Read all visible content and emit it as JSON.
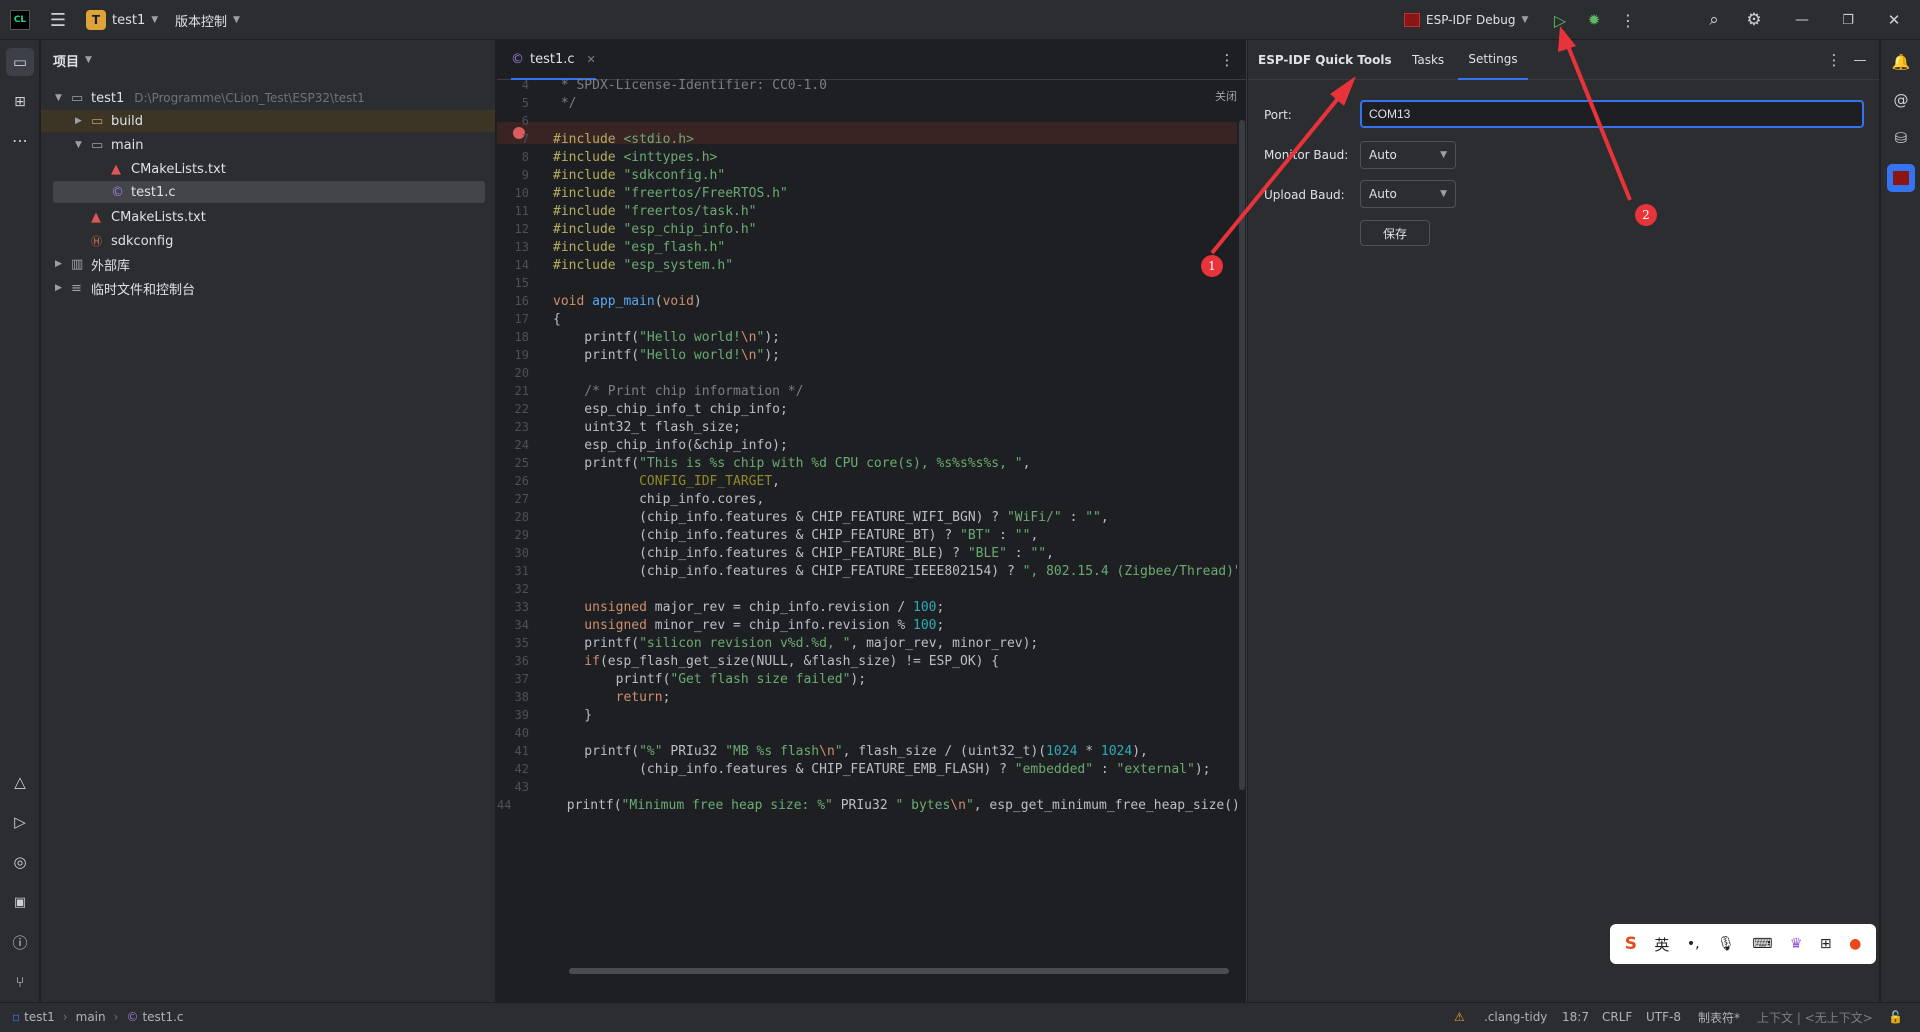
{
  "titlebar": {
    "project_badge": "T",
    "project_name": "test1",
    "vcs_label": "版本控制",
    "run_config": "ESP-IDF Debug"
  },
  "project_panel": {
    "title": "项目",
    "root_name": "test1",
    "root_path": "D:\\Programme\\CLion_Test\\ESP32\\test1",
    "items": [
      {
        "label": "build"
      },
      {
        "label": "main"
      },
      {
        "label": "CMakeLists.txt"
      },
      {
        "label": "test1.c"
      },
      {
        "label": "CMakeLists.txt"
      },
      {
        "label": "sdkconfig"
      },
      {
        "label": "外部库"
      },
      {
        "label": "临时文件和控制台"
      }
    ]
  },
  "editor": {
    "tab_label": "test1.c",
    "close_hint": "关闭",
    "line_numbers": [
      "4",
      "5",
      "6",
      "7",
      "8",
      "9",
      "10",
      "11",
      "12",
      "13",
      "14",
      "15",
      "16",
      "17",
      "18",
      "19",
      "20",
      "21",
      "22",
      "23",
      "24",
      "25",
      "26",
      "27",
      "28",
      "29",
      "30",
      "31",
      "32",
      "33",
      "34",
      "35",
      "36",
      "37",
      "38",
      "39",
      "40",
      "41",
      "42",
      "43",
      "44"
    ]
  },
  "tool_window": {
    "title": "ESP-IDF Quick Tools",
    "tabs": [
      "Tasks",
      "Settings"
    ],
    "port_label": "Port:",
    "port_value": "COM13",
    "monitor_label": "Monitor Baud:",
    "monitor_value": "Auto",
    "upload_label": "Upload Baud:",
    "upload_value": "Auto",
    "save_label": "保存"
  },
  "annotations": {
    "badge1": "1",
    "badge2": "2"
  },
  "ime": {
    "lang": "英"
  },
  "statusbar": {
    "crumbs": [
      "test1",
      "main",
      "test1.c"
    ],
    "inspection": ".clang-tidy",
    "position": "18:7",
    "line_sep": "CRLF",
    "encoding": "UTF-8",
    "indent": "制表符*",
    "context": "上下文 | <无上下文>"
  },
  "colors": {
    "accent": "#3574f0",
    "run": "#5fb865",
    "breakpoint": "#db5c5c",
    "annotation": "#e8333a"
  }
}
